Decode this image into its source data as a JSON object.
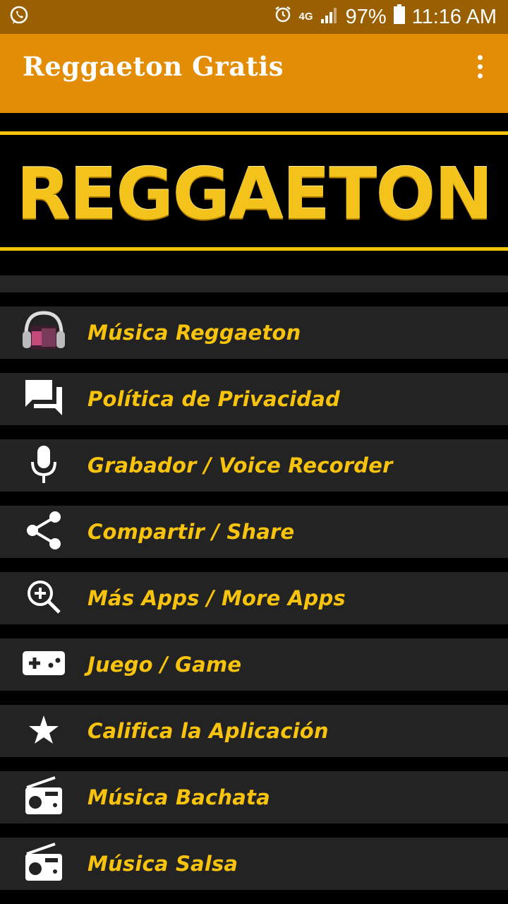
{
  "status_bar": {
    "notification_icon": "whatsapp-icon",
    "alarm_icon": "alarm-icon",
    "network": "4G",
    "battery": "97%",
    "time": "11:16 AM"
  },
  "app_bar": {
    "title": "Reggaeton Gratis",
    "menu_icon": "overflow-menu-icon"
  },
  "banner": {
    "logo_text": "REGGAETON",
    "colors": {
      "gold": "#f5c20a",
      "background": "#000000"
    }
  },
  "colors": {
    "app_bar": "#e38c05",
    "status_bar": "#9a5f00",
    "label": "#f7c30e",
    "row": "#232323"
  },
  "menu": [
    {
      "label": "Música Reggaeton",
      "icon": "headphones-icon"
    },
    {
      "label": "Política de Privacidad",
      "icon": "chat-bubbles-icon"
    },
    {
      "label": "Grabador / Voice Recorder",
      "icon": "microphone-icon"
    },
    {
      "label": "Compartir / Share",
      "icon": "share-icon"
    },
    {
      "label": "Más Apps / More Apps",
      "icon": "zoom-in-icon"
    },
    {
      "label": "Juego / Game",
      "icon": "gamepad-icon"
    },
    {
      "label": "Califica la Aplicación",
      "icon": "star-icon"
    },
    {
      "label": "Música Bachata",
      "icon": "radio-icon"
    },
    {
      "label": "Música Salsa",
      "icon": "radio-icon"
    }
  ]
}
